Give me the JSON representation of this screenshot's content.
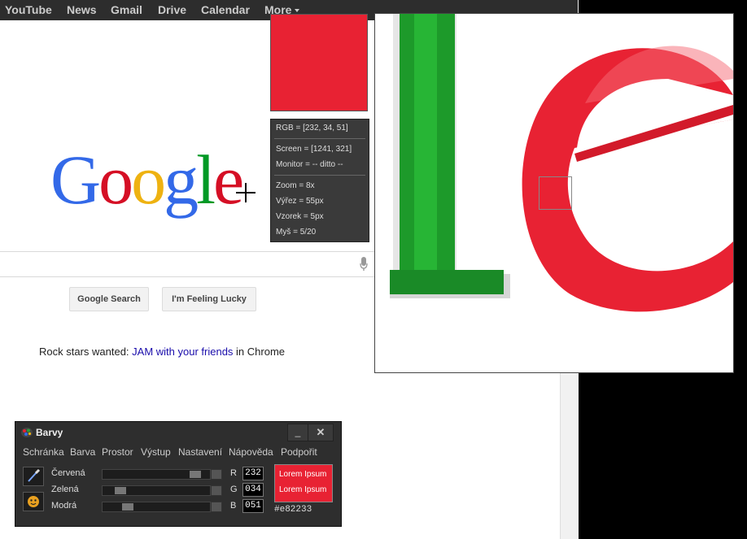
{
  "google_bar": {
    "links": [
      "YouTube",
      "News",
      "Gmail",
      "Drive",
      "Calendar",
      "More"
    ]
  },
  "google_page": {
    "logo_letters": [
      "G",
      "o",
      "o",
      "g",
      "l",
      "e"
    ],
    "search_button": "Google Search",
    "lucky_button": "I'm Feeling Lucky",
    "promo_prefix": "Rock stars wanted: ",
    "promo_link": "JAM with your friends",
    "promo_suffix": " in Chrome"
  },
  "picker_info": {
    "rgb": "RGB = [232, 34, 51]",
    "screen": "Screen = [1241, 321]",
    "monitor": "Monitor = -- ditto --",
    "zoom": "Zoom = 8x",
    "vyrez": "Výřez = 55px",
    "vzorek": "Vzorek = 5px",
    "mys": "Myš = 5/20"
  },
  "barvy": {
    "title": "Barvy",
    "minimize": "_",
    "close": "✕",
    "menu": [
      "Schránka",
      "Barva",
      "Prostor",
      "Výstup",
      "Nastavení",
      "Nápověda",
      "Podpořit"
    ],
    "channels": [
      {
        "label": "Červená",
        "letter": "R",
        "value": "232",
        "level": 0.91
      },
      {
        "label": "Zelená",
        "letter": "G",
        "value": "034",
        "level": 0.13
      },
      {
        "label": "Modrá",
        "letter": "B",
        "value": "051",
        "level": 0.2
      }
    ],
    "preview_text_1": "Lorem Ipsum",
    "preview_text_2": "Lorem Ipsum",
    "hex": "#e82233"
  },
  "colors": {
    "picked": "#e82233",
    "google_blue": "#3369e8",
    "google_red": "#d50f25",
    "google_yellow": "#eeb211",
    "google_green": "#009925"
  }
}
